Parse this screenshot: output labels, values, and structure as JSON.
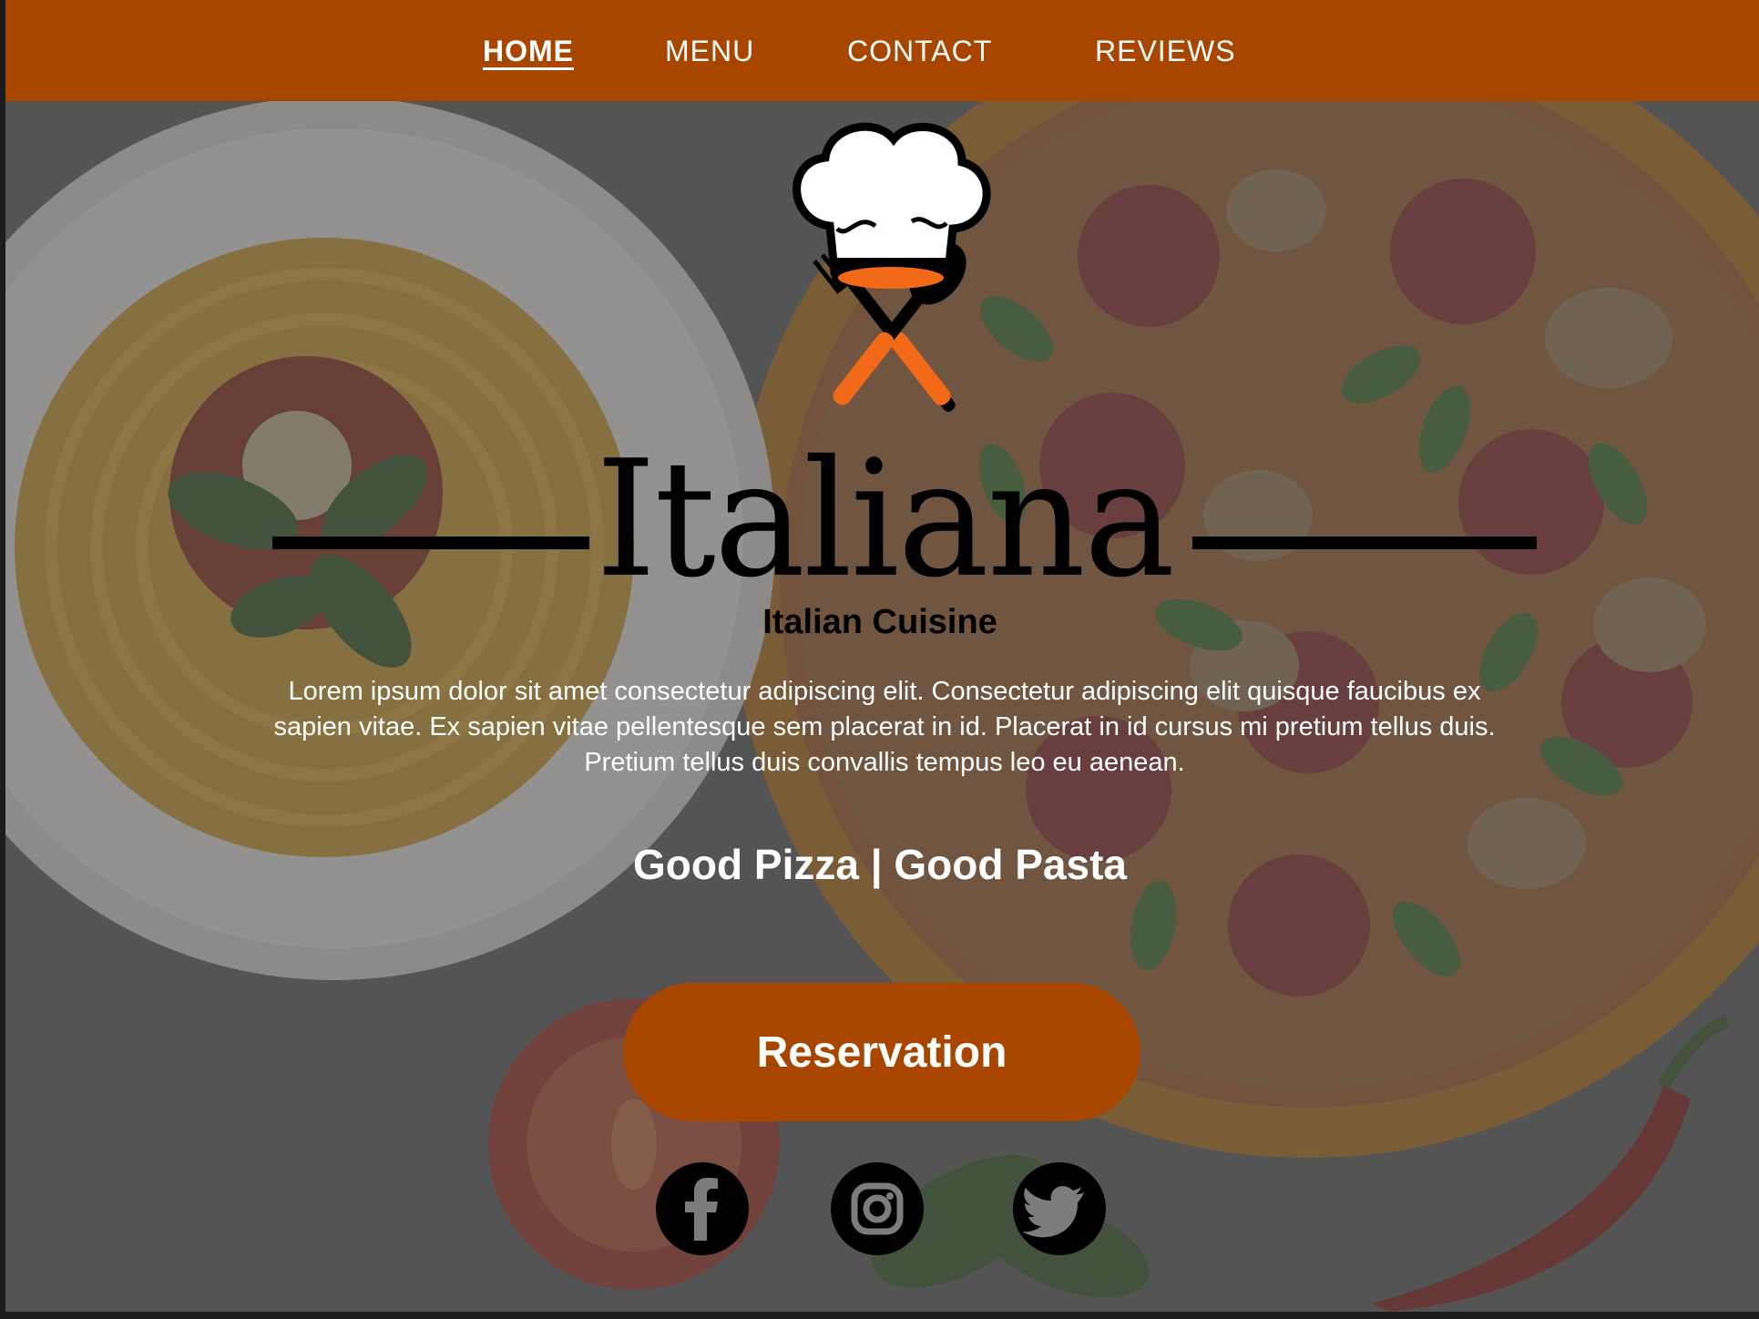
{
  "nav": {
    "items": [
      {
        "label": "HOME",
        "active": true
      },
      {
        "label": "MENU",
        "active": false
      },
      {
        "label": "CONTACT",
        "active": false
      },
      {
        "label": "REVIEWS",
        "active": false
      }
    ]
  },
  "hero": {
    "title": "Italiana",
    "subtitle": "Italian Cuisine",
    "intro": "Lorem ipsum dolor sit amet consectetur adipiscing elit. Consectetur adipiscing elit quisque faucibus ex sapien vitae. Ex sapien vitae pellentesque sem placerat in id. Placerat in id cursus mi pretium tellus duis. Pretium tellus duis convallis tempus leo eu aenean.",
    "tagline": "Good Pizza | Good Pasta",
    "cta_label": "Reservation"
  },
  "logo": {
    "icon": "chef-hat-spoon-fork-icon"
  },
  "social": [
    {
      "icon": "facebook-icon"
    },
    {
      "icon": "instagram-icon"
    },
    {
      "icon": "twitter-icon"
    }
  ],
  "colors": {
    "brand": "#a84600",
    "text_light": "#ffffff",
    "text_dark": "#000000",
    "logo_accent": "#f26a17"
  }
}
